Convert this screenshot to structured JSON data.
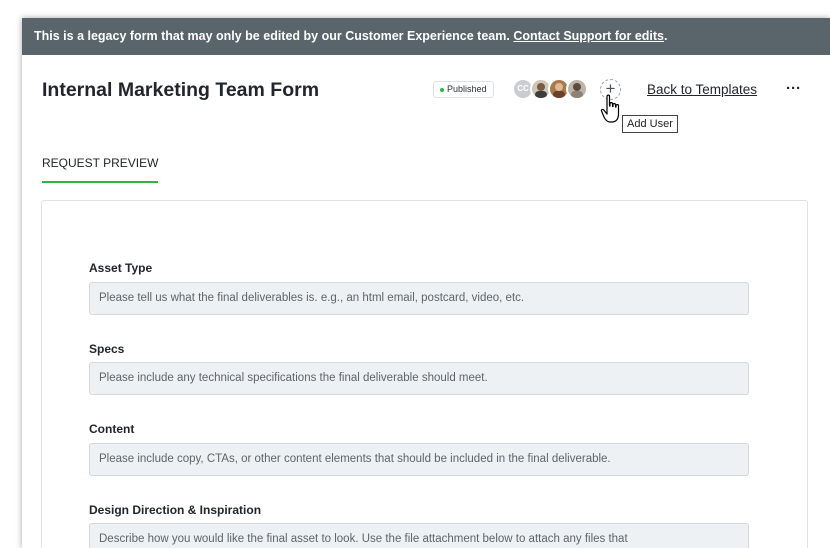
{
  "banner": {
    "text": "This is a legacy form that may only be edited by our Customer Experience team. ",
    "link": "Contact Support for edits",
    "suffix": "."
  },
  "header": {
    "title": "Internal Marketing Team Form",
    "status": "Published",
    "avatar_initials": "CC",
    "add_user_icon": "+",
    "tooltip": "Add User",
    "back_link": "Back to Templates",
    "more_icon": "···"
  },
  "tab": {
    "label": "REQUEST PREVIEW"
  },
  "form": {
    "fields": [
      {
        "label": "Asset Type",
        "placeholder": "Please tell us what the final deliverables is. e.g., an html email, postcard, video, etc."
      },
      {
        "label": "Specs",
        "placeholder": "Please include any technical specifications the final deliverable should meet."
      },
      {
        "label": "Content",
        "placeholder": "Please include copy, CTAs, or other content elements that should be included in the final deliverable."
      },
      {
        "label": "Design Direction & Inspiration",
        "placeholder": "Describe how you would like the final asset to look. Use the file attachment below to attach any files that"
      }
    ]
  },
  "colors": {
    "banner": "#59646b",
    "accent": "#2fb344",
    "input_bg": "#eef1f3"
  },
  "icons": [
    "more-icon",
    "add-user-icon",
    "pointer-cursor-icon",
    "status-dot-icon"
  ]
}
